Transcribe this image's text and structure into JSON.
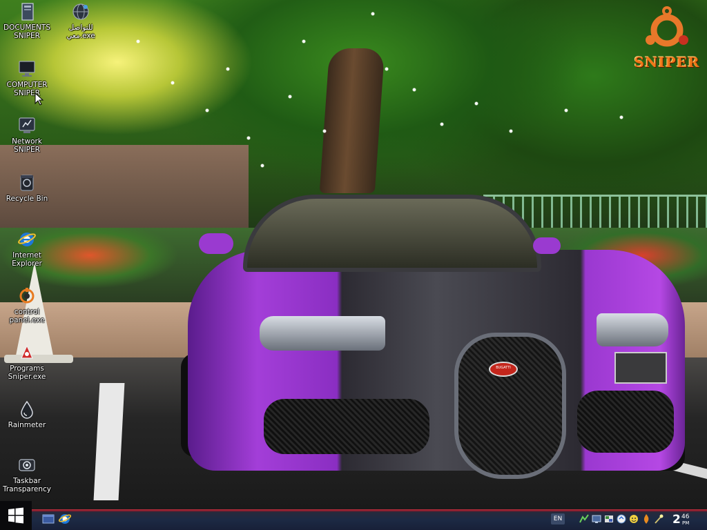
{
  "desktop": {
    "icons": [
      {
        "id": "documents",
        "label": "DOCUMENTS SNIPER",
        "icon": "folder-document-icon"
      },
      {
        "id": "social",
        "label": "للتواصل معي.exe",
        "icon": "globe-icon"
      },
      {
        "id": "computer",
        "label": "COMPUTER SNIPER",
        "icon": "monitor-icon"
      },
      {
        "id": "network",
        "label": "Network SNIPER",
        "icon": "network-icon"
      },
      {
        "id": "recycle",
        "label": "Recycle Bin",
        "icon": "recycle-bin-icon"
      },
      {
        "id": "ie",
        "label": "Internet Explorer",
        "icon": "internet-explorer-icon"
      },
      {
        "id": "control",
        "label": "control panel.exe",
        "icon": "control-panel-icon"
      },
      {
        "id": "programs",
        "label": "Programs Sniper.exe",
        "icon": "programs-icon"
      },
      {
        "id": "rainmeter",
        "label": "Rainmeter",
        "icon": "rainmeter-drop-icon"
      },
      {
        "id": "taskbar_transparency",
        "label": "Taskbar Transparency",
        "icon": "taskbar-transparency-icon"
      }
    ],
    "logo_text": "SNIPER",
    "logo_icon": "ubuntu-logo-icon",
    "wallpaper": "purple-sports-car-night-trees",
    "car_badge_text": "BUGATTI"
  },
  "taskbar": {
    "start_icon": "windows-logo-icon",
    "quick_launch": [
      "show-desktop-icon",
      "internet-explorer-icon"
    ],
    "language": "EN",
    "tray_icons": [
      "network-icon",
      "monitor-icon",
      "security-icon",
      "windows-update-icon",
      "emoticon-icon",
      "flame-icon",
      "wand-icon"
    ],
    "clock": {
      "hour": "2",
      "minute": "46",
      "ampm": "PM"
    },
    "accent_color": "#c03040",
    "bar_color": "#1c2a44"
  }
}
